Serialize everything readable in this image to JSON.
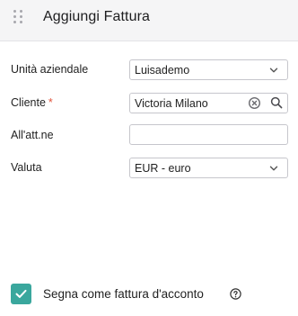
{
  "header": {
    "title": "Aggiungi Fattura"
  },
  "form": {
    "business_unit": {
      "label": "Unità aziendale",
      "value": "Luisademo"
    },
    "client": {
      "label": "Cliente",
      "required_mark": "*",
      "value": "Victoria Milano"
    },
    "attention": {
      "label": "All'att.ne",
      "value": ""
    },
    "currency": {
      "label": "Valuta",
      "value": "EUR - euro"
    }
  },
  "footer": {
    "advance_invoice_label": "Segna come fattura d'acconto",
    "advance_invoice_checked": true
  },
  "colors": {
    "accent": "#3aa79d",
    "required": "#e0533c",
    "header_bg": "#f5f5f6"
  },
  "icons": {
    "drag": "drag-handle-icon",
    "dropdown": "chevron-down-icon",
    "clear": "clear-icon",
    "search": "search-icon",
    "check": "check-icon",
    "help": "help-icon"
  }
}
